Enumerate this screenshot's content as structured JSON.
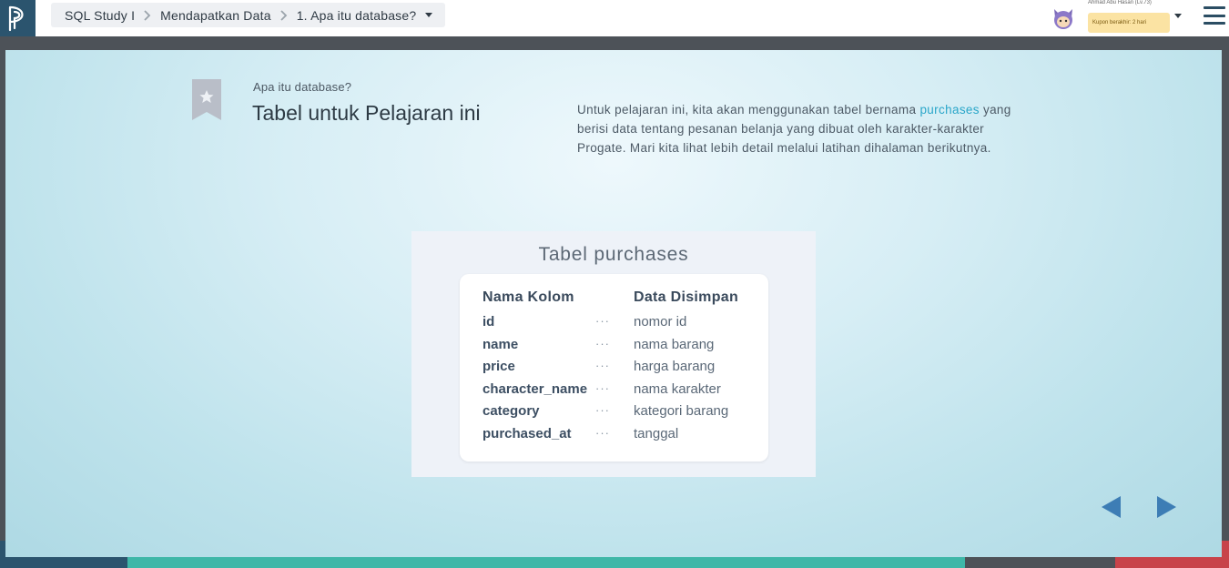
{
  "breadcrumb": {
    "course": "SQL Study I",
    "section": "Mendapatkan Data",
    "lesson": "1. Apa itu database?"
  },
  "user": {
    "name": "Ahmad Abu Hasan (Lv.73)",
    "coupon": "Kupon berakhir: 2 hari"
  },
  "slide": {
    "subtitle": "Apa itu database?",
    "title": "Tabel untuk Pelajaran ini",
    "desc_before": "Untuk pelajaran ini, kita akan menggunakan tabel bernama ",
    "desc_highlight": "purchases",
    "desc_after": " yang berisi data tentang pesanan belanja yang dibuat oleh karakter-karakter Progate. Mari kita lihat lebih detail melalui latihan dihalaman berikutnya."
  },
  "table": {
    "title": "Tabel purchases",
    "col1_header": "Nama Kolom",
    "col2_header": "Data Disimpan",
    "separator": "···",
    "rows": [
      {
        "name": "id",
        "data": "nomor id"
      },
      {
        "name": "name",
        "data": "nama barang"
      },
      {
        "name": "price",
        "data": "harga barang"
      },
      {
        "name": "character_name",
        "data": "nama karakter"
      },
      {
        "name": "category",
        "data": "kategori barang"
      },
      {
        "name": "purchased_at",
        "data": "tanggal"
      }
    ]
  },
  "colors": {
    "accent": "#2aa6c9",
    "nav_arrow": "#3d7db5",
    "logo_bg": "#2b546e"
  },
  "icons": {
    "logo": "progate-logo-icon",
    "bookmark": "bookmark-star-icon",
    "menu": "hamburger-menu-icon",
    "prev": "prev-arrow-icon",
    "next": "next-arrow-icon"
  }
}
